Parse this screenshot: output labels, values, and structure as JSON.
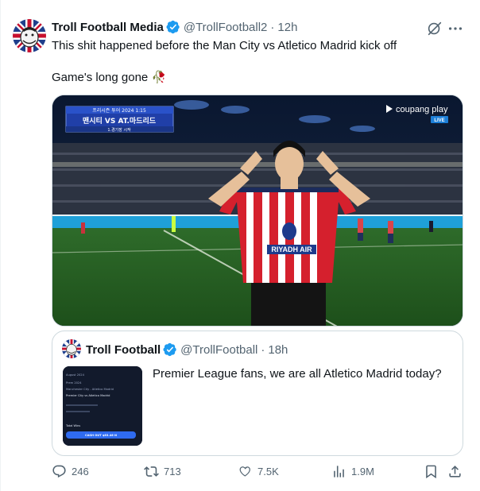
{
  "tweet": {
    "display_name": "Troll Football Media",
    "handle": "@TrollFootball2",
    "time": "12h",
    "separator": "·",
    "text_line1": "This shit happened before the Man City vs Atletico Madrid kick off",
    "text_line2": "Game's long gone 🥀",
    "media": {
      "scoreboard_small": "프리시즌 투어 2024 1:15",
      "scoreboard_teams": "맨시티 VS AT.마드리드",
      "scoreboard_bottom": "1.경기장 시작",
      "broadcaster": "coupang play",
      "live_badge": "LIVE",
      "shirt_sponsor": "RIYADH AIR"
    }
  },
  "quote": {
    "display_name": "Troll Football",
    "handle": "@TrollFootball",
    "time": "18h",
    "separator": "·",
    "text": "Premier League fans, we are all Atletico Madrid today?",
    "thumb_lines": [
      "August 2024",
      "Prem 2024",
      "Manchester City - Atletico Madrid",
      "Premier City vs Atletico Madrid",
      "Total Wins"
    ],
    "thumb_button": "CASH OUT $83.46 N"
  },
  "actions": {
    "replies": "246",
    "reposts": "713",
    "likes": "7.5K",
    "views": "1.9M"
  },
  "icons": {
    "verified": "verified-badge-icon",
    "grok": "grok-icon",
    "more": "more-icon",
    "reply": "reply-icon",
    "repost": "repost-icon",
    "like": "heart-icon",
    "views": "views-icon",
    "bookmark": "bookmark-icon",
    "share": "share-icon"
  },
  "colors": {
    "verified_blue": "#1d9bf0",
    "text": "#0f1419",
    "muted": "#536471",
    "border": "#cfd9de"
  }
}
